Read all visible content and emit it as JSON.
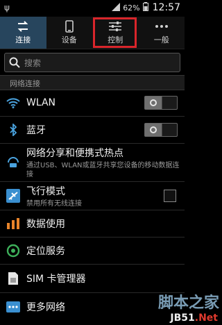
{
  "status": {
    "battery": "62%",
    "time": "12:57"
  },
  "tabs": [
    {
      "label": "连接"
    },
    {
      "label": "设备"
    },
    {
      "label": "控制"
    },
    {
      "label": "一般"
    }
  ],
  "search": {
    "placeholder": "搜索"
  },
  "section": {
    "title": "网络连接"
  },
  "items": [
    {
      "title": "WLAN",
      "subtitle": "",
      "icon": "wifi-icon",
      "toggle_on": false
    },
    {
      "title": "蓝牙",
      "subtitle": "",
      "icon": "bluetooth-icon",
      "toggle_on": false
    },
    {
      "title": "网络分享和便携式热点",
      "subtitle": "通过USB、WLAN或蓝牙共享您设备的移动数据连接",
      "icon": "hotspot-icon"
    },
    {
      "title": "飞行模式",
      "subtitle": "禁用所有无线连接",
      "icon": "airplane-icon",
      "checked": false
    },
    {
      "title": "数据使用",
      "subtitle": "",
      "icon": "data-usage-icon"
    },
    {
      "title": "定位服务",
      "subtitle": "",
      "icon": "location-icon"
    },
    {
      "title": "SIM 卡管理器",
      "subtitle": "",
      "icon": "sim-card-icon"
    },
    {
      "title": "更多网络",
      "subtitle": "",
      "icon": "more-networks-icon"
    }
  ],
  "watermark": {
    "site_pre": "脚本之家",
    "url_a": "JB51",
    "url_b": ".Net"
  },
  "colors": {
    "active_tab": "#27455d",
    "highlight": "#d9252b"
  }
}
